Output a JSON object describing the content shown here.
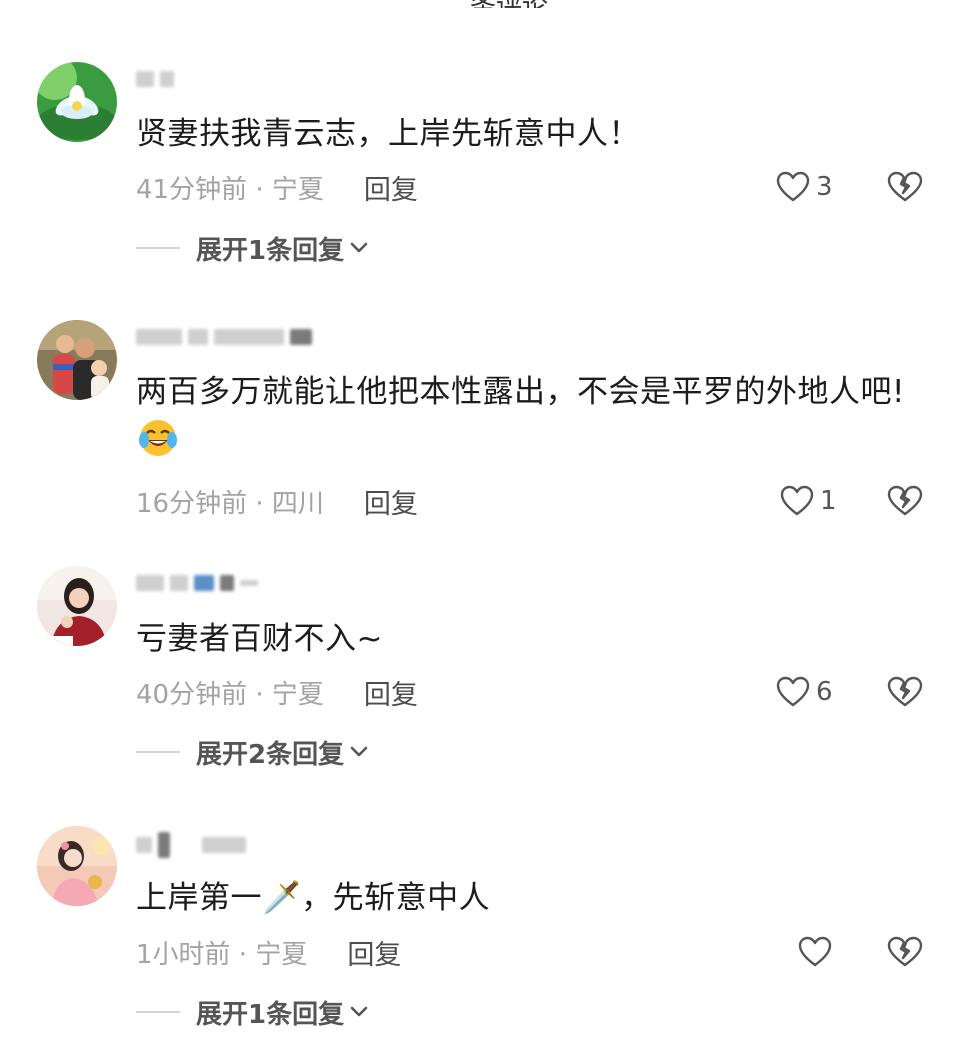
{
  "header": {
    "clipped_title": "条评论"
  },
  "comments": [
    {
      "text": "贤妻扶我青云志，上岸先斩意中人！",
      "time": "41分钟前 · 宁夏",
      "reply_label": "回复",
      "likes": "3",
      "expand_label": "展开1条回复",
      "avatar_icon": "lotus-avatar"
    },
    {
      "text": "两百多万就能让他把本性露出，不会是平罗的外地人吧!",
      "time": "16分钟前 · 四川",
      "reply_label": "回复",
      "likes": "1",
      "expand_label": "",
      "avatar_icon": "family-avatar"
    },
    {
      "text": "亏妻者百财不入~",
      "time": "40分钟前 · 宁夏",
      "reply_label": "回复",
      "likes": "6",
      "expand_label": "展开2条回复",
      "avatar_icon": "woman-red-sweater-avatar"
    },
    {
      "text": "上岸第一🗡️，先斩意中人",
      "time": "1小时前 · 宁夏",
      "reply_label": "回复",
      "likes": "",
      "expand_label": "展开1条回复",
      "avatar_icon": "girl-sunset-avatar"
    }
  ],
  "icons": {
    "like": "heart-outline-icon",
    "dislike": "broken-heart-icon",
    "expand": "chevron-down-icon",
    "emoji": "crying-laughing-emoji"
  },
  "colors": {
    "text": "#1c1c1c",
    "meta": "#a3a3a3",
    "reply": "#4d4d4d",
    "expand": "#555555"
  }
}
